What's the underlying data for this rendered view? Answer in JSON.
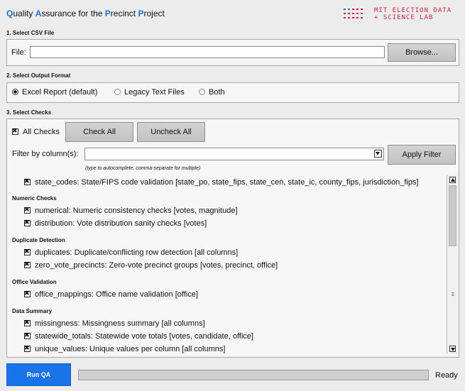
{
  "header": {
    "title_parts": [
      {
        "text": "Q",
        "hl": true
      },
      {
        "text": "uality ",
        "hl": false
      },
      {
        "text": "A",
        "hl": true
      },
      {
        "text": "ssurance for the ",
        "hl": false
      },
      {
        "text": "P",
        "hl": true
      },
      {
        "text": "recinct ",
        "hl": false
      },
      {
        "text": "P",
        "hl": true
      },
      {
        "text": "roject",
        "hl": false
      }
    ],
    "logo_line1": "MIT ELECTION DATA",
    "logo_line2": "+ SCIENCE LAB"
  },
  "section1": {
    "label": "1. Select CSV File",
    "file_label": "File:",
    "file_value": "",
    "browse_label": "Browse..."
  },
  "section2": {
    "label": "2. Select Output Format",
    "options": [
      {
        "label": "Excel Report (default)",
        "selected": true
      },
      {
        "label": "Legacy Text Files",
        "selected": false
      },
      {
        "label": "Both",
        "selected": false
      }
    ]
  },
  "section3": {
    "label": "3. Select Checks",
    "all_checks_label": "All Checks",
    "check_all_label": "Check All",
    "uncheck_all_label": "Uncheck All",
    "filter_label": "Filter by column(s):",
    "filter_value": "",
    "apply_filter_label": "Apply Filter",
    "hint": "(type to autocomplete, comma-separate for multiple)",
    "state_codes": "state_codes: State/FIPS code validation [state_po, state_fips, state_cen, state_ic, county_fips, jurisdiction_fips]",
    "numeric_title": "Numeric Checks",
    "numerical": "numerical: Numeric consistency checks [votes, magnitude]",
    "distribution": "distribution: Vote distribution sanity checks [votes]",
    "dup_title": "Duplicate Detection",
    "duplicates": "duplicates: Duplicate/conflicting row detection [all columns]",
    "zero_vote": "zero_vote_precincts: Zero-vote precinct groups [votes, precinct, office]",
    "office_title": "Office Validation",
    "office_mappings": "office_mappings: Office name validation [office]",
    "summary_title": "Data Summary",
    "missingness": "missingness: Missingness summary [all columns]",
    "statewide": "statewide_totals: Statewide vote totals [votes, candidate, office]",
    "unique": "unique_values: Unique values per column [all columns]"
  },
  "footer": {
    "run_label": "Run QA",
    "progress": 0,
    "status": "Ready"
  },
  "colors": {
    "accent": "#1a73e8",
    "title_highlight": "#1f6fd1",
    "logo": "#d21f3c"
  }
}
